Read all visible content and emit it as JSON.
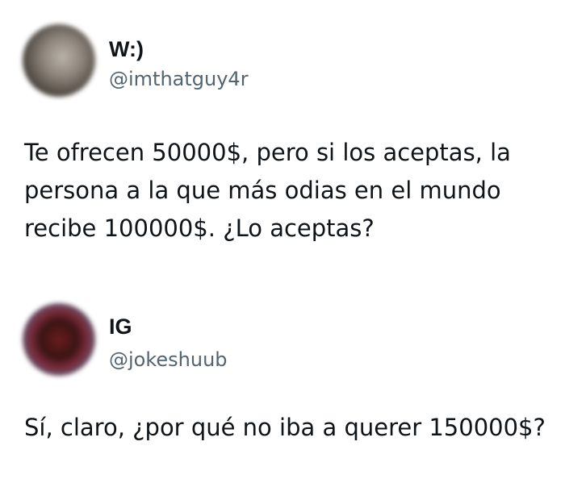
{
  "tweets": [
    {
      "display_name": "W:)",
      "handle": "@imthatguy4r",
      "text": "Te ofrecen 50000$, pero si los aceptas, la\npersona a la que más odias en el mundo\nrecibe 100000$. ¿Lo aceptas?"
    },
    {
      "display_name": "IG",
      "handle": "@jokeshuub",
      "text": "Sí, claro, ¿por qué no iba a querer 150000$?"
    }
  ]
}
